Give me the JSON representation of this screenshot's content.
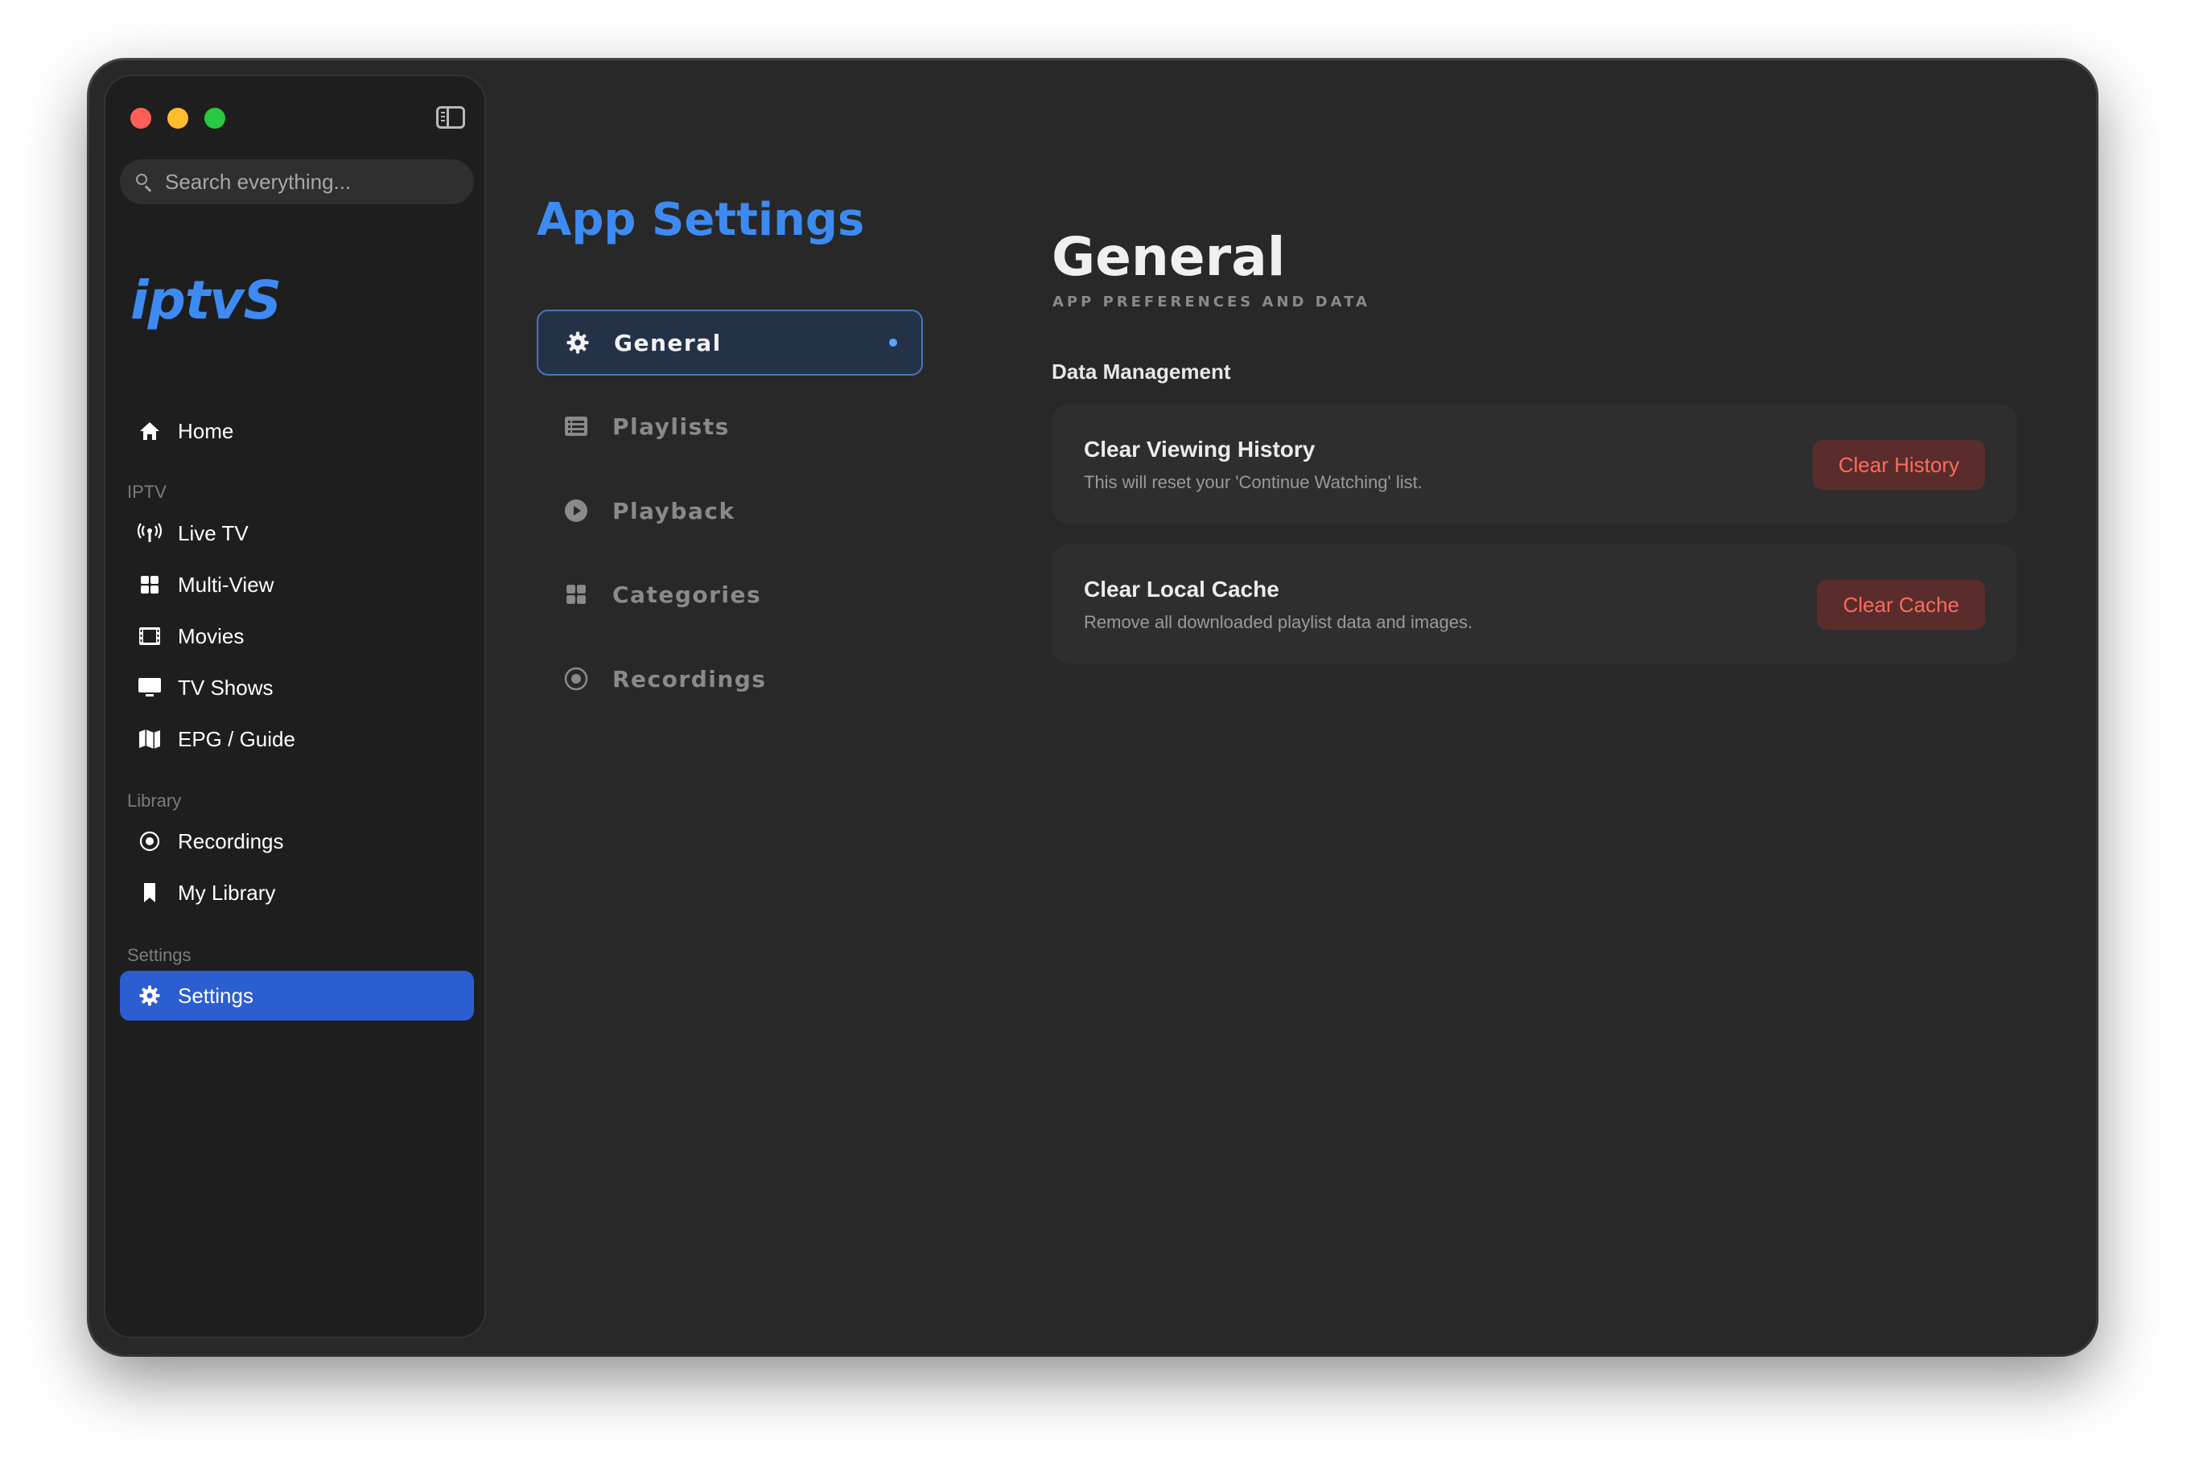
{
  "window": {
    "traffic_lights": [
      "close",
      "minimize",
      "zoom"
    ]
  },
  "sidebar": {
    "search": {
      "placeholder": "Search everything..."
    },
    "brand": "iptvS",
    "home": {
      "label": "Home",
      "icon": "house-icon"
    },
    "sections": {
      "iptv": "IPTV",
      "library": "Library",
      "settings": "Settings"
    },
    "iptv_items": [
      {
        "label": "Live TV",
        "icon": "antenna-icon"
      },
      {
        "label": "Multi-View",
        "icon": "grid-icon"
      },
      {
        "label": "Movies",
        "icon": "film-icon"
      },
      {
        "label": "TV Shows",
        "icon": "tv-icon"
      },
      {
        "label": "EPG / Guide",
        "icon": "map-icon"
      }
    ],
    "library_items": [
      {
        "label": "Recordings",
        "icon": "record-icon"
      },
      {
        "label": "My Library",
        "icon": "bookmark-icon"
      }
    ],
    "settings_item": {
      "label": "Settings",
      "icon": "gear-icon",
      "active": true
    }
  },
  "settings_nav": {
    "title": "App Settings",
    "tabs": [
      {
        "label": "General",
        "icon": "gear-icon",
        "active": true
      },
      {
        "label": "Playlists",
        "icon": "list-icon"
      },
      {
        "label": "Playback",
        "icon": "play-icon"
      },
      {
        "label": "Categories",
        "icon": "grid-icon"
      },
      {
        "label": "Recordings",
        "icon": "record-icon"
      }
    ]
  },
  "content": {
    "title": "General",
    "subtitle": "APP PREFERENCES AND DATA",
    "group": "Data Management",
    "cards": [
      {
        "title": "Clear Viewing History",
        "description": "This will reset your 'Continue Watching' list.",
        "button": "Clear History"
      },
      {
        "title": "Clear Local Cache",
        "description": "Remove all downloaded playlist data and images.",
        "button": "Clear Cache"
      }
    ]
  },
  "colors": {
    "accent": "#3d8bf2",
    "active_sidebar": "#2b5ed1",
    "danger_text": "#ff6b5e",
    "danger_bg": "#5a2c2c"
  }
}
